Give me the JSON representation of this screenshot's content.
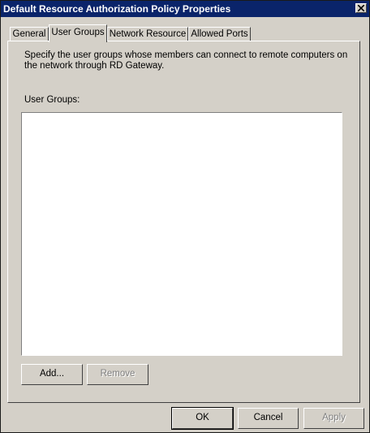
{
  "window": {
    "title": "Default Resource Authorization Policy Properties",
    "close_icon": "close-icon"
  },
  "tabs": [
    {
      "label": "General",
      "active": false
    },
    {
      "label": "User Groups",
      "active": true
    },
    {
      "label": "Network Resource",
      "active": false
    },
    {
      "label": "Allowed Ports",
      "active": false
    }
  ],
  "panel": {
    "description": "Specify the user groups whose members can connect to remote computers on the network through RD Gateway.",
    "list_label": "User Groups:",
    "list_items": [],
    "add_label": "Add...",
    "remove_label": "Remove"
  },
  "footer": {
    "ok_label": "OK",
    "cancel_label": "Cancel",
    "apply_label": "Apply"
  },
  "colors": {
    "titlebar": "#0a246a",
    "face": "#d4d0c8",
    "disabled_text": "#808080"
  }
}
